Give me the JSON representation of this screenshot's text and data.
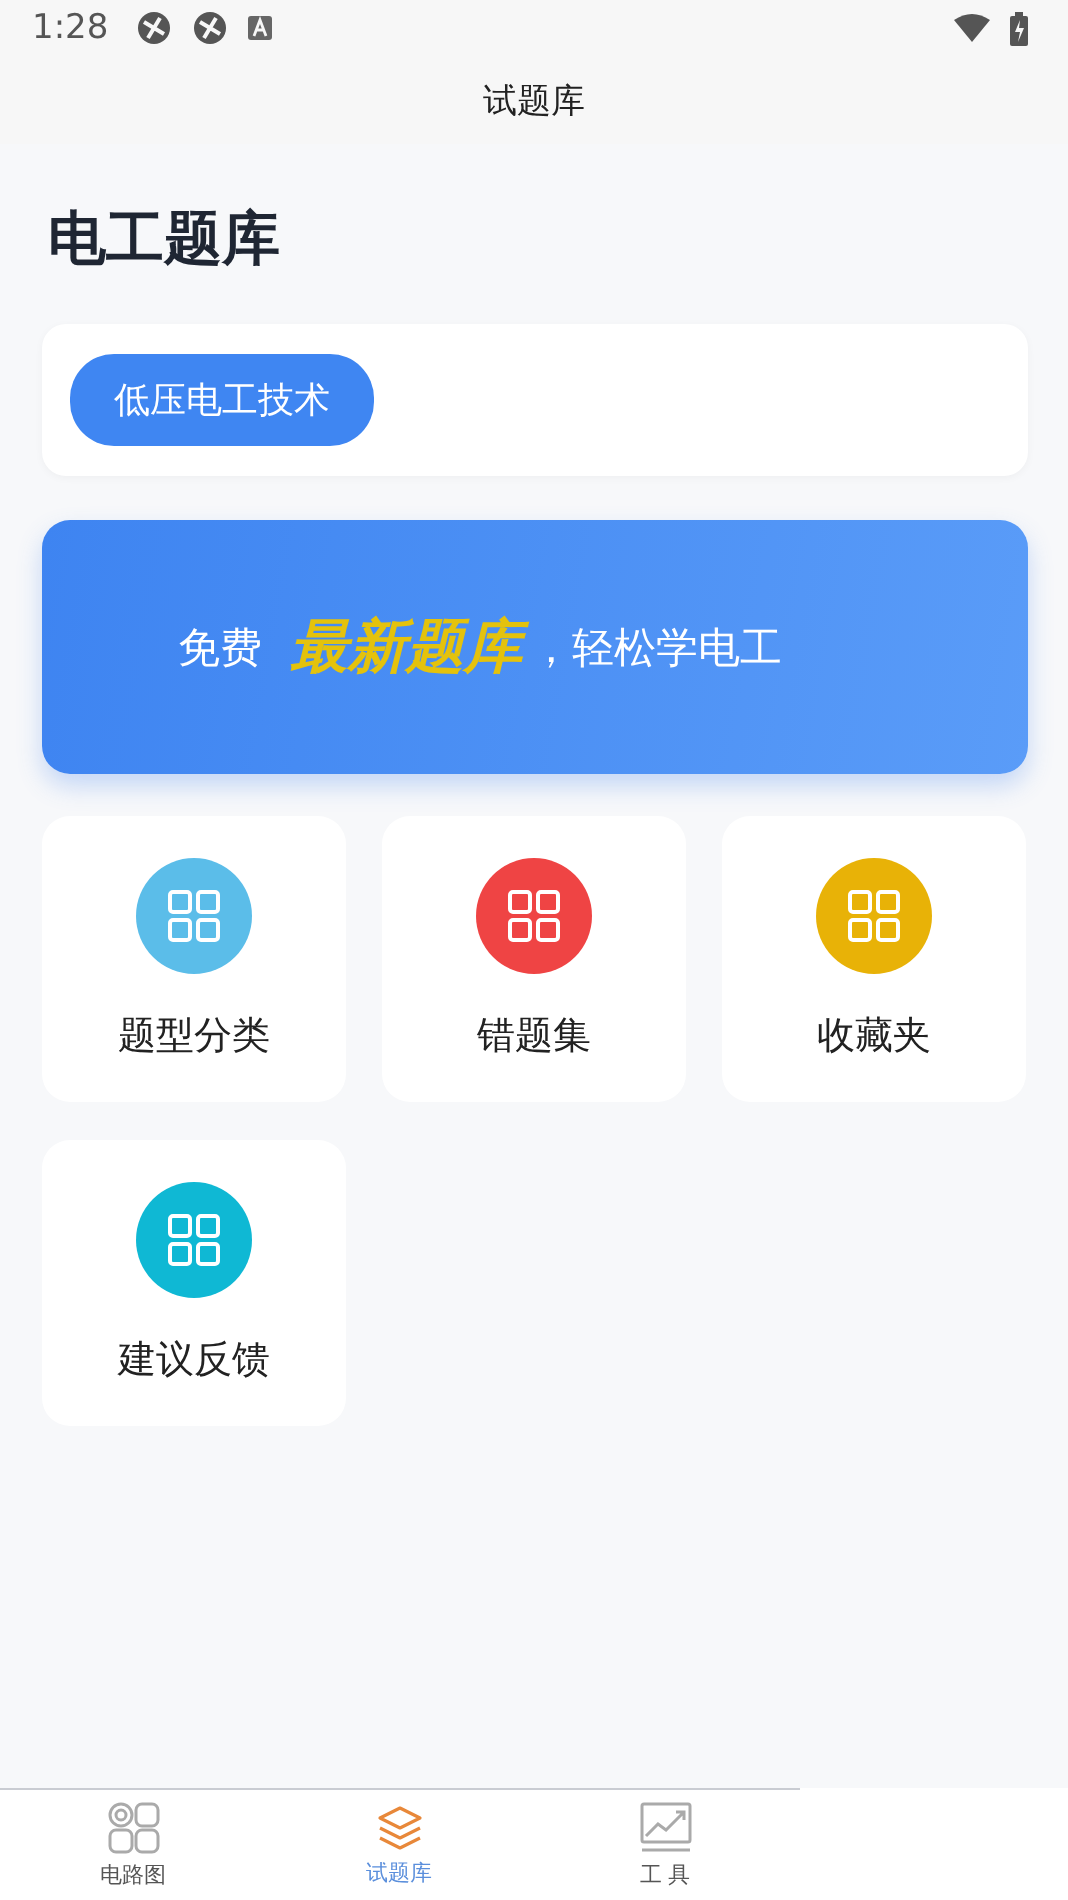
{
  "status_bar": {
    "time": "1:28"
  },
  "header": {
    "title": "试题库"
  },
  "page_title": "电工题库",
  "categories": [
    {
      "label": "低压电工技术",
      "selected": true
    }
  ],
  "banner": {
    "lead": "免费",
    "highlight": "最新题库",
    "tail": "，轻松学电工"
  },
  "tiles": [
    {
      "label": "题型分类",
      "color": "#5bbde9"
    },
    {
      "label": "错题集",
      "color": "#ef4444"
    },
    {
      "label": "收藏夹",
      "color": "#e8b207"
    },
    {
      "label": "建议反馈",
      "color": "#0fb8d4"
    }
  ],
  "nav": [
    {
      "kind": "circuit",
      "label": "电路图",
      "selected": false
    },
    {
      "kind": "layers",
      "label": "试题库",
      "selected": true
    },
    {
      "kind": "chart",
      "label": "工 具",
      "selected": false
    }
  ]
}
